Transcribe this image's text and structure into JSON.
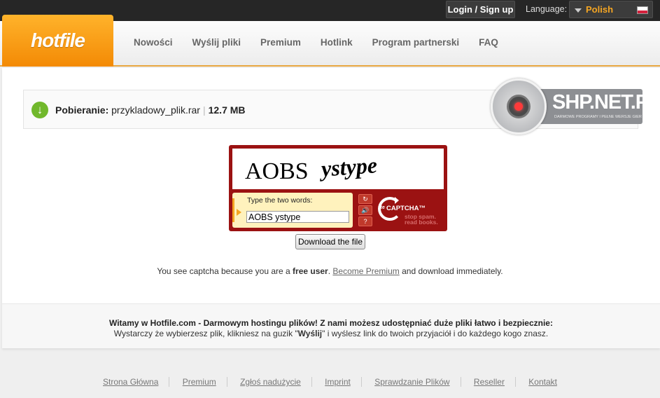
{
  "topbar": {
    "login_label": "Login / Sign up",
    "language_label": "Language:",
    "language_value": "Polish"
  },
  "header": {
    "logo": "hotfile",
    "nav": [
      "Nowości",
      "Wyślij pliki",
      "Premium",
      "Hotlink",
      "Program partnerski",
      "FAQ"
    ]
  },
  "download": {
    "prefix": "Pobieranie:",
    "filename": "przykladowy_plik.rar",
    "size": "12.7 MB"
  },
  "watermark": {
    "title": "SHP.NET.PL",
    "subtitle": "DARMOWE PROGRAMY I PEŁNE WERSJE GIER"
  },
  "captcha": {
    "word1": "AOBS",
    "word2": "ystype",
    "prompt": "Type the two words:",
    "input_value": "AOBS ystype",
    "refresh_icon": "↻",
    "audio_icon": "🔊",
    "help_icon": "?",
    "brand_re": "Re",
    "brand_name": "CAPTCHA™",
    "tagline1": "stop spam.",
    "tagline2": "read books."
  },
  "download_button": "Download the file",
  "info": {
    "text1": "You see captcha because you are a ",
    "bold": "free user",
    "text2": ". ",
    "link": "Become Premium",
    "text3": " and download immediately."
  },
  "welcome": {
    "line1": "Witamy w Hotfile.com - Darmowym hostingu plików! Z nami możesz udostępniać duże pliki łatwo i bezpiecznie:",
    "line2a": "Wystarczy że wybierzesz plik, klikniesz na guzik \"",
    "line2b": "Wyślij",
    "line2c": "\" i wyślesz link do twoich przyjaciół i do każdego kogo znasz."
  },
  "footer": [
    "Strona Główna",
    "Premium",
    "Zgłoś nadużycie",
    "Imprint",
    "Sprawdzanie Plików",
    "Reseller",
    "Kontakt"
  ]
}
